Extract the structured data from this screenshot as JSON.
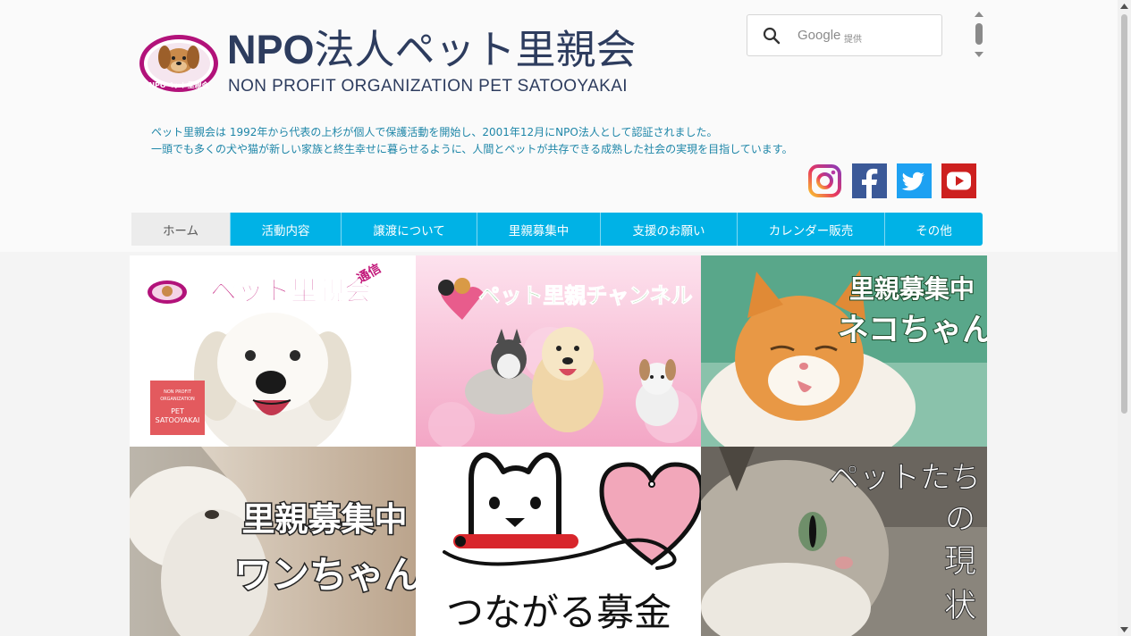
{
  "header": {
    "title_npo": "NPO",
    "title_rest": "法人ペット里親会",
    "subtitle": "NON PROFIT ORGANIZATION PET SATOOYAKAI",
    "logo_text": "NPOペット里親会"
  },
  "search": {
    "brand": "Google",
    "provided": "提供"
  },
  "intro": {
    "line1": "ペット里親会は 1992年から代表の上杉が個人で保護活動を開始し、2001年12月にNPO法人として認証されました。",
    "line2": "一頭でも多くの犬や猫が新しい家族と終生幸せに暮らせるように、人間とペットが共存できる成熟した社会の実現を目指しています。"
  },
  "social": [
    "instagram-icon",
    "facebook-icon",
    "twitter-icon",
    "youtube-icon"
  ],
  "nav": {
    "items": [
      {
        "label": "ホーム"
      },
      {
        "label": "活動内容"
      },
      {
        "label": "譲渡について"
      },
      {
        "label": "里親募集中"
      },
      {
        "label": "支援のお願い"
      },
      {
        "label": "カレンダー販売"
      },
      {
        "label": "その他"
      }
    ]
  },
  "tiles": {
    "t1": {
      "title": "ペット里親会",
      "sub": "通信",
      "card1": "NON PROFIT",
      "card2": "ORGANIZATION",
      "card3": "PET",
      "card4": "SATOOYAKAI"
    },
    "t2": {
      "title": "ペット里親チャンネル"
    },
    "t3": {
      "line1": "里親募集中",
      "line2": "ネコちゃん"
    },
    "t4": {
      "line1": "里親募集中",
      "line2": "ワンちゃん"
    },
    "t5": {
      "title": "つながる募金"
    },
    "t6": {
      "line1": "ペットたち",
      "line2": "の",
      "line3": "現",
      "line4": "状"
    }
  },
  "colors": {
    "nav_bg": "#00b2e6",
    "title": "#2d3c5e",
    "intro_text": "#1e86a8",
    "logo_magenta": "#b2127a"
  }
}
